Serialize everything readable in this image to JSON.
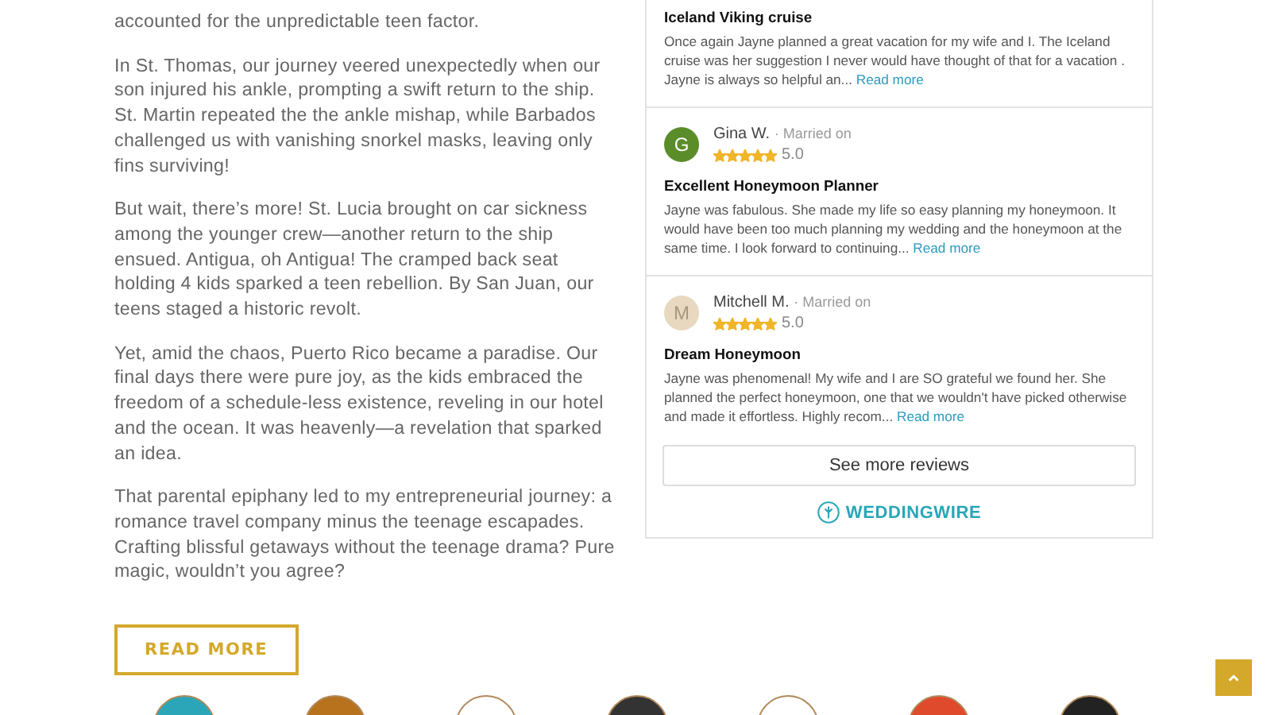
{
  "article": {
    "paragraphs": [
      "accounted for the unpredictable teen factor.",
      "In St. Thomas, our journey veered unexpectedly when our son injured his ankle, prompting a swift return to the ship.  St. Martin repeated the the ankle mishap, while Barbados challenged us with vanishing snorkel masks, leaving only fins surviving!",
      "But wait, there’s more! St. Lucia brought on car sickness among the younger crew—another return to the ship ensued.  Antigua, oh Antigua!  The cramped back seat holding 4 kids sparked a teen rebellion. By San Juan, our teens staged a historic revolt.",
      "Yet, amid the chaos, Puerto Rico became a paradise.  Our final days there were pure joy, as the kids embraced the freedom of a schedule-less existence, reveling in our hotel and the ocean.  It was heavenly—a revelation that sparked an idea.",
      "That parental epiphany led to my entrepreneurial journey: a romance travel company minus the teenage escapades.  Crafting blissful getaways without the teenage drama?  Pure magic, wouldn’t you agree?"
    ],
    "button": "READ MORE"
  },
  "reviews": {
    "items": [
      {
        "title": "Iceland Viking cruise",
        "body": "Once again Jayne planned a great vacation for my wife and I. The Iceland cruise was her suggestion I never would have thought of that for a vacation . Jayne is always so helpful an...",
        "read_more": "Read more"
      },
      {
        "initial": "G",
        "color": "#5b8c2a",
        "name": "Gina W.",
        "meta": "· Married on",
        "stars": 5,
        "rating": "5.0",
        "title": "Excellent Honeymoon Planner",
        "body": "Jayne was fabulous. She made my life so easy planning my honeymoon. It would have been too much planning my wedding and the honeymoon at the same time. I look forward to continuing...",
        "read_more": "Read more"
      },
      {
        "initial": "M",
        "color": "#e8d8bf",
        "name": "Mitchell M.",
        "meta": "· Married on",
        "stars": 5,
        "rating": "5.0",
        "title": "Dream Honeymoon",
        "body": "Jayne was phenomenal! My wife and I are SO grateful we found her. She planned the perfect honeymoon, one that we wouldn't have picked otherwise and made it effortless. Highly recom...",
        "read_more": "Read more"
      }
    ],
    "see_more": "See more reviews",
    "brand": "WEDDINGWIRE"
  }
}
